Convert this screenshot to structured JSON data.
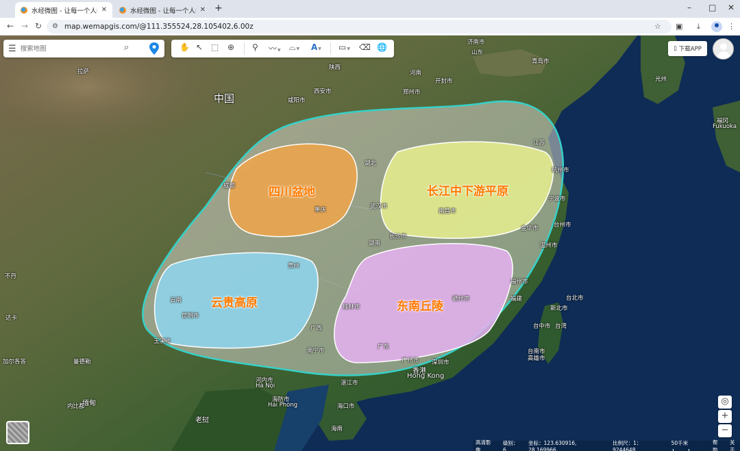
{
  "browser": {
    "tabs": [
      {
        "title": "水经微图 - 让每一个人都有自己",
        "active": true
      },
      {
        "title": "水经微图 - 让每一个人都有自己",
        "active": false
      }
    ],
    "new_tab": "+",
    "url": "map.wemapgis.com/@111.355524,28.105402,6.00z",
    "window_controls": [
      "–",
      "□",
      "✕"
    ]
  },
  "map_ui": {
    "search_placeholder": "搜索地图",
    "download_app": "下载APP",
    "zoom_in": "+",
    "zoom_out": "−",
    "locate": "◎"
  },
  "regions": [
    {
      "name": "四川盆地",
      "color": "#f0a64a"
    },
    {
      "name": "长江中下游平原",
      "color": "#e8ef8e"
    },
    {
      "name": "云贵高原",
      "color": "#8ed6f0"
    },
    {
      "name": "东南丘陵",
      "color": "#e6b2f2"
    }
  ],
  "outline_color": "#36d1c9",
  "map_labels": {
    "china": "中国",
    "shaanxi": "陕西",
    "xian": "西安市",
    "henan": "河南",
    "zhengzhou": "郑州市",
    "shandong": "山东",
    "jinan": "济南市",
    "qingdao": "青岛市",
    "jiangsu": "江苏",
    "hubei": "湖北",
    "hunan": "湖南",
    "chongqing": "重庆",
    "chengdu": "成都",
    "guizhou": "贵州",
    "yunnan": "云南",
    "kunming": "昆明市",
    "guangxi": "广西",
    "nanning": "南宁市",
    "guangdong": "广东",
    "guangzhou": "广州市",
    "fujian": "福建",
    "fuzhou": "福州市",
    "taiwan": "台湾",
    "taibei": "台北市",
    "xinbei": "新北市",
    "gaoxiong": "高雄市",
    "taizhong": "台中市",
    "tainan": "台南市",
    "hongkong": "香港",
    "hongkong_en": "Hong Kong",
    "hanoi": "河内市",
    "hanoi_en": "Hà Nội",
    "haiphong": "海防市",
    "haiphong_en": "Hải Phòng",
    "hainan": "海南",
    "haikou": "海口市",
    "laos": "老挝",
    "myanmar": "缅甸",
    "mandalay": "曼德勒",
    "naypyidaw": "内比都",
    "lhasa": "拉萨",
    "dhaka": "达卡",
    "kolkata": "加尔各答",
    "bhutan": "不丹",
    "guangzhou_ja": "光州",
    "fukuoka": "福冈",
    "fukuoka_en": "Fukuoka",
    "wenzhou": "温州市",
    "ningbo": "宁波市",
    "hangzhou": "杭州市",
    "nanchang": "南昌市",
    "jinhua": "金华市",
    "taizhou": "台州市",
    "yuxi": "玉溪市",
    "zhanjiang": "湛江市",
    "shenzhen": "深圳市",
    "changsha": "长沙市",
    "wuhan": "武汉市",
    "xianyang": "咸阳市",
    "kaifeng": "开封市",
    "ganzhou": "赣州市",
    "guilin": "桂林市"
  },
  "status": {
    "source": "高清影像",
    "level_label": "级别：",
    "level": "6",
    "coord_label": "坐标：",
    "coord": "123.630916, 28.169966",
    "scale_label": "比例尺：",
    "scale": "1：9244648",
    "scale_bar": "50千米",
    "help": "帮助",
    "about": "关于"
  }
}
